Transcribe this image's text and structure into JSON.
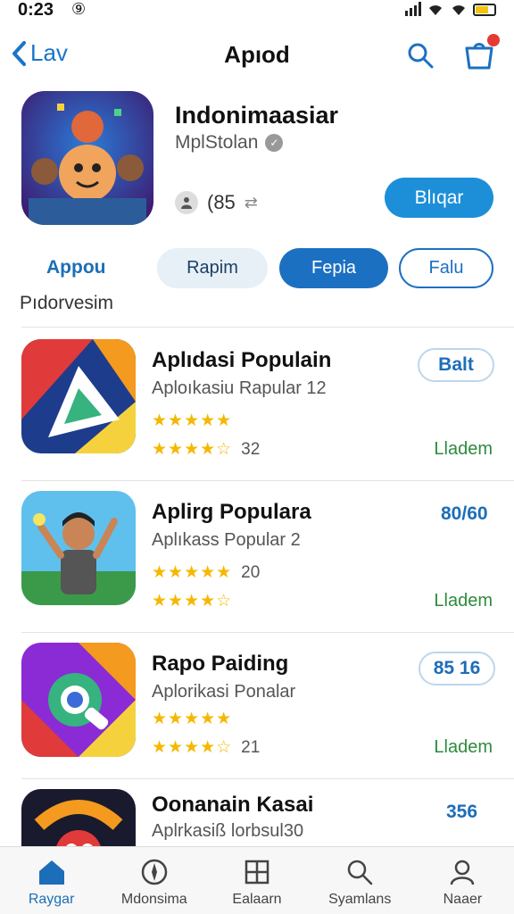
{
  "status": {
    "time": "0:23",
    "glyph": "⑨"
  },
  "nav": {
    "back_label": "Lav",
    "title": "Apıod"
  },
  "app": {
    "name": "Indonimaasiar",
    "developer": "MplStolan",
    "meta_value": "(85",
    "get_label": "Blıqar"
  },
  "chips": {
    "label": "Appou",
    "items": [
      "Rapim",
      "Fepia",
      "Falu"
    ]
  },
  "section_title": "Pıdorvesim",
  "rows": [
    {
      "title": "Aplıdasi Populain",
      "subtitle": "Aploıkasiu Rapular 12",
      "rating_count": "32",
      "action": "Balt",
      "status": "Lladem"
    },
    {
      "title": "Aplirg Populara",
      "subtitle": "Aplıkass Popular 2",
      "rating_count": "20",
      "action": "80/60",
      "status": "Lladem"
    },
    {
      "title": "Rapo Paiding",
      "subtitle": "Aplorikasi Ponalar",
      "rating_count": "21",
      "action": "85 16",
      "status": "Lladem"
    },
    {
      "title": "Oonanain Kasai",
      "subtitle": "Aplrkasiß lorbsul30",
      "action": "356",
      "status": ""
    }
  ],
  "tabs": [
    "Raygar",
    "Mdonsima",
    "Ealaarn",
    "Syamlans",
    "Naaer"
  ],
  "colors": {
    "accent": "#1c70c2",
    "star": "#f5b800",
    "status_green": "#2e8b3d"
  }
}
